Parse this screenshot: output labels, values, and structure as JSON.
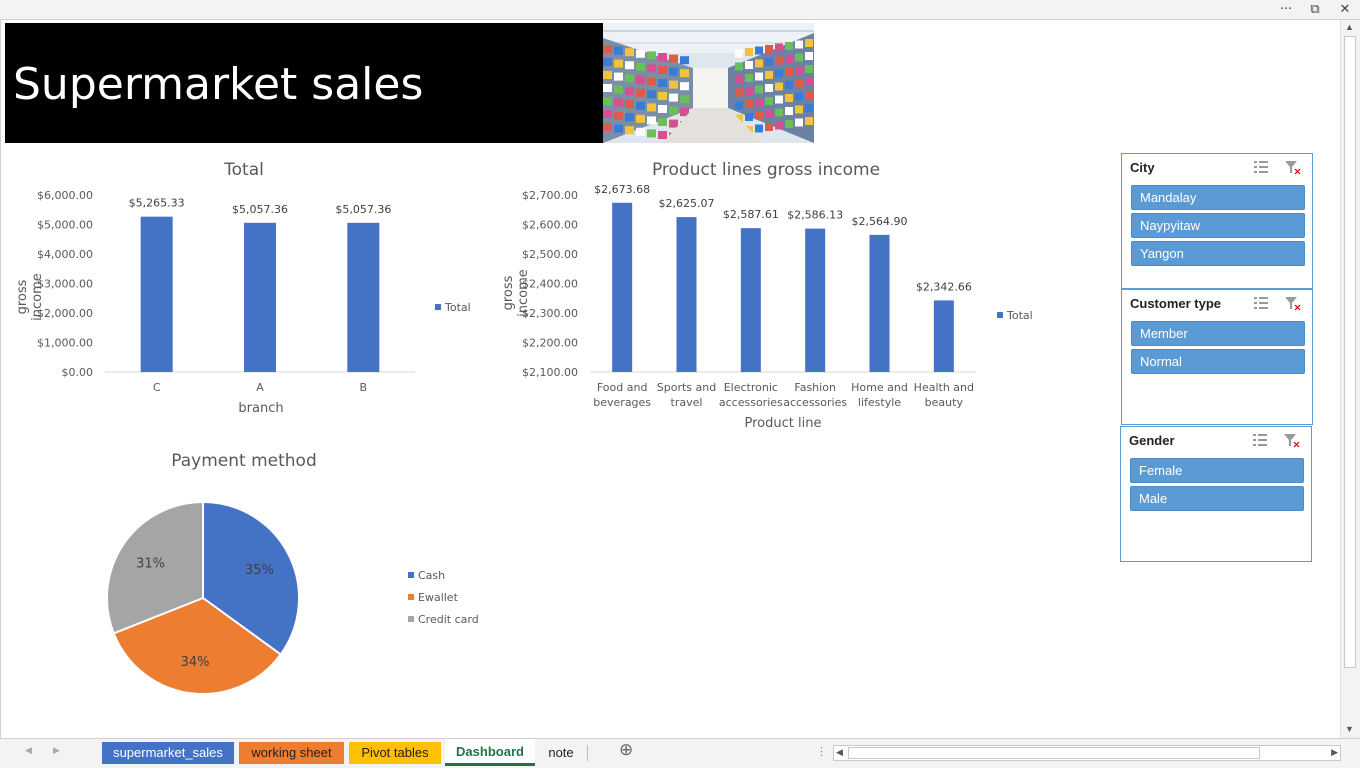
{
  "window": {
    "more_glyph": "···",
    "restore_glyph": "⧉",
    "close_glyph": "✕"
  },
  "banner": {
    "title": "Supermarket sales",
    "photo_icon": "supermarket-aisle-photo"
  },
  "chart_data": [
    {
      "type": "bar",
      "title": "Total",
      "xlabel": "branch",
      "ylabel": "gross income",
      "categories": [
        "C",
        "A",
        "B"
      ],
      "series": [
        {
          "name": "Total",
          "values": [
            5265.33,
            5057.36,
            5057.36
          ]
        }
      ],
      "data_labels": [
        "$5,265.33",
        "$5,057.36",
        "$5,057.36"
      ],
      "y_ticks": [
        "$0.00",
        "$1,000.00",
        "$2,000.00",
        "$3,000.00",
        "$4,000.00",
        "$5,000.00",
        "$6,000.00"
      ],
      "ylim": [
        0,
        6000
      ],
      "legend": "right",
      "color": "#4472c4"
    },
    {
      "type": "bar",
      "title": "Product lines gross income",
      "xlabel": "Product line",
      "ylabel": "gross income",
      "categories": [
        [
          "Food and",
          "beverages"
        ],
        [
          "Sports and",
          "travel"
        ],
        [
          "Electronic",
          "accessories"
        ],
        [
          "Fashion",
          "accessories"
        ],
        [
          "Home and",
          "lifestyle"
        ],
        [
          "Health and",
          "beauty"
        ]
      ],
      "series": [
        {
          "name": "Total",
          "values": [
            2673.68,
            2625.07,
            2587.61,
            2586.13,
            2564.9,
            2342.66
          ]
        }
      ],
      "data_labels": [
        "$2,673.68",
        "$2,625.07",
        "$2,587.61",
        "$2,586.13",
        "$2,564.90",
        "$2,342.66"
      ],
      "y_ticks": [
        "$2,100.00",
        "$2,200.00",
        "$2,300.00",
        "$2,400.00",
        "$2,500.00",
        "$2,600.00",
        "$2,700.00"
      ],
      "ylim": [
        2100,
        2700
      ],
      "legend": "right",
      "color": "#4472c4"
    },
    {
      "type": "pie",
      "title": "Payment method",
      "labels": [
        "Cash",
        "Ewallet",
        "Credit card"
      ],
      "values": [
        35,
        34,
        31
      ],
      "data_labels": [
        "35%",
        "34%",
        "31%"
      ],
      "colors": [
        "#4472c4",
        "#ed7d31",
        "#a5a5a5"
      ],
      "legend": "right"
    }
  ],
  "slicers": [
    {
      "title": "City",
      "items": [
        "Mandalay",
        "Naypyitaw",
        "Yangon"
      ]
    },
    {
      "title": "Customer type",
      "items": [
        "Member",
        "Normal"
      ]
    },
    {
      "title": "Gender",
      "items": [
        "Female",
        "Male"
      ]
    }
  ],
  "sheet_tabs": [
    {
      "label": "supermarket_sales",
      "color": "#4472c4",
      "text_color": "#ffffff"
    },
    {
      "label": "working sheet",
      "color": "#ed7d31",
      "text_color": "#222222"
    },
    {
      "label": "Pivot tables",
      "color": "#ffc000",
      "text_color": "#222222"
    },
    {
      "label": "Dashboard",
      "color": "#ffffff",
      "text_color": "#217346",
      "active": true
    },
    {
      "label": "note",
      "color": "#f3f3f3",
      "text_color": "#222222"
    }
  ],
  "nav": {
    "add_sheet_glyph": "⊕",
    "prev_glyph": "◀",
    "next_glyph": "▶"
  }
}
